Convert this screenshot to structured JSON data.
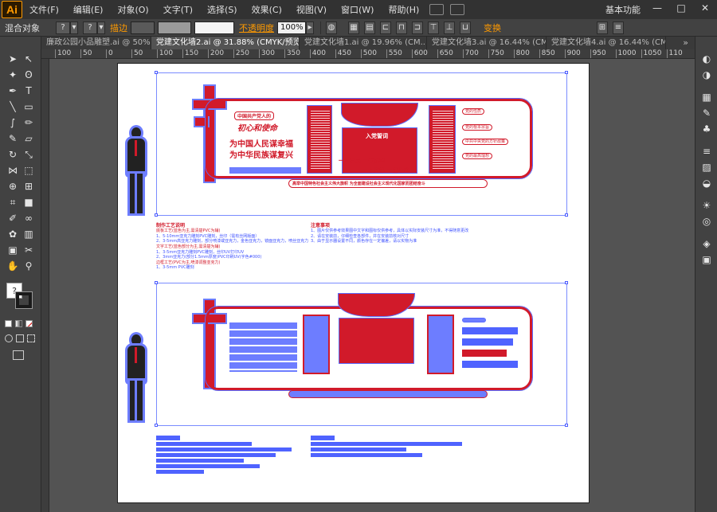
{
  "app": {
    "logo": "Ai",
    "menu": [
      "文件(F)",
      "编辑(E)",
      "对象(O)",
      "文字(T)",
      "选择(S)",
      "效果(C)",
      "视图(V)",
      "窗口(W)",
      "帮助(H)"
    ],
    "workspace": "基本功能",
    "window_buttons": [
      "—",
      "□",
      "✕"
    ]
  },
  "control_bar": {
    "object_label": "混合对象",
    "fill_value": "?",
    "stroke_value": "?",
    "stroke_label": "描边",
    "opacity_label": "不透明度",
    "opacity_value": "100%",
    "transform_label": "变换"
  },
  "tabs": [
    {
      "label": "廉政公园小品雕塑.ai @ 50% (C...",
      "active": false
    },
    {
      "label": "党建文化墙2.ai @ 31.88% (CMYK/预览)",
      "active": true
    },
    {
      "label": "党建文化墙1.ai @ 19.96% (CM...",
      "active": false
    },
    {
      "label": "党建文化墙3.ai @ 16.44% (CM...",
      "active": false
    },
    {
      "label": "党建文化墙4.ai @ 16.44% (CM...",
      "active": false
    }
  ],
  "tabs_more": "»",
  "ruler": {
    "ticks": [
      "100",
      "50",
      "0",
      "50",
      "100",
      "150",
      "200",
      "250",
      "300",
      "350",
      "400",
      "450",
      "500",
      "550",
      "600",
      "650",
      "700",
      "750",
      "800",
      "850",
      "900",
      "950",
      "1000",
      "1050",
      "110"
    ]
  },
  "tools": [
    "selection-tool",
    "direct-selection-tool",
    "magic-wand-tool",
    "lasso-tool",
    "pen-tool",
    "type-tool",
    "line-tool",
    "rectangle-tool",
    "paintbrush-tool",
    "pencil-tool",
    "blob-brush-tool",
    "eraser-tool",
    "rotate-tool",
    "scale-tool",
    "width-tool",
    "free-transform-tool",
    "shape-builder-tool",
    "perspective-tool",
    "mesh-tool",
    "gradient-tool",
    "eyedropper-tool",
    "blend-tool",
    "symbol-sprayer-tool",
    "column-graph-tool",
    "artboard-tool",
    "slice-tool",
    "hand-tool",
    "zoom-tool"
  ],
  "tool_glyphs": {
    "selection": "➤",
    "direct": "↖",
    "wand": "✦",
    "lasso": "ʘ",
    "pen": "✒",
    "type": "T",
    "line": "╲",
    "rect": "▭",
    "brush": "∫",
    "pencil": "✏",
    "blob": "✎",
    "eraser": "▱",
    "rotate": "↻",
    "scale": "⤡",
    "width": "⋈",
    "free": "⬚",
    "builder": "⊕",
    "persp": "⊞",
    "mesh": "⌗",
    "gradient": "■",
    "eyedrop": "✐",
    "blend": "∞",
    "sprayer": "✿",
    "graph": "▥",
    "artboard": "▣",
    "slice": "✂",
    "hand": "✋",
    "zoom": "⚲",
    "help": "?",
    "fill_stroke": "■"
  },
  "right_panel_icons": [
    "color-icon",
    "color-guide-icon",
    "swatches-icon",
    "brushes-icon",
    "symbols-icon",
    "stroke-icon",
    "gradient-icon",
    "transparency-icon",
    "appearance-icon",
    "graphic-styles-icon",
    "layers-icon",
    "artboards-icon"
  ],
  "right_panel_glyphs": [
    "◐",
    "◑",
    "▦",
    "✎",
    "♣",
    "≡",
    "▨",
    "◒",
    "☀",
    "◎",
    "◈",
    "▣"
  ],
  "artwork": {
    "top": {
      "slogan_small": "中国共产党人的",
      "slogan_script": "初心和使命",
      "line1": "为中国人民谋幸福",
      "line2": "为中华民族谋复兴",
      "oath_title": "入党誓词",
      "motto1": "一名党员 一面旗帜",
      "motto2": "一个支部 一座堡垒",
      "bottom_banner": "高举中国特色社会主义伟大旗帜 为全面建设社会主义现代化国家而团结奋斗",
      "right_items": [
        "党的性质",
        "党的根本宗旨",
        "中共中央党的方针政策",
        "党的最高理想"
      ],
      "notes_left_title": "制作工艺说明",
      "notes_left": [
        "底板工艺(蓝色为主,需清楚PVC为辅)",
        "1、5-10mm亚克力雕刻PVC雕刻，丝印（需有丝网版面）",
        "2、3-5mm高亚克力雕刻，部分喷漆或亚克力，金色亚克力，镜面亚克力，喷丝亚克力",
        "文字工艺(蓝色部分为主,需清楚为辅)",
        "1、3-5mm亚克力雕刻PVC雕刻，丝印UV打印UV",
        "2、3mm亚克力(部分1.5mm厚度)PVC印刷UV(字色#000)",
        "边框工艺(PVC为主,喷漆调整亚克力)",
        "1、3-5mm PVC雕刻"
      ],
      "notes_right_title": "注意事项",
      "notes_right": [
        "1、图片仅供参考效果图中文字和图标仅供参考，具体以实际安装尺寸为准，不得随意更改",
        "2、请在安装前，仔细检查各部件，并在安装前核对尺寸",
        "3、由于显示器设置不同，颜色存在一定偏差，请以实物为准"
      ]
    }
  },
  "colors": {
    "brand_red": "#d11a2a",
    "selection_blue": "#5a6cff",
    "fill_blue": "#6d7dff",
    "ui_dark": "#323232",
    "ui_panel": "#424242",
    "canvas_bg": "#535353",
    "accent_orange": "#ff9a00"
  }
}
